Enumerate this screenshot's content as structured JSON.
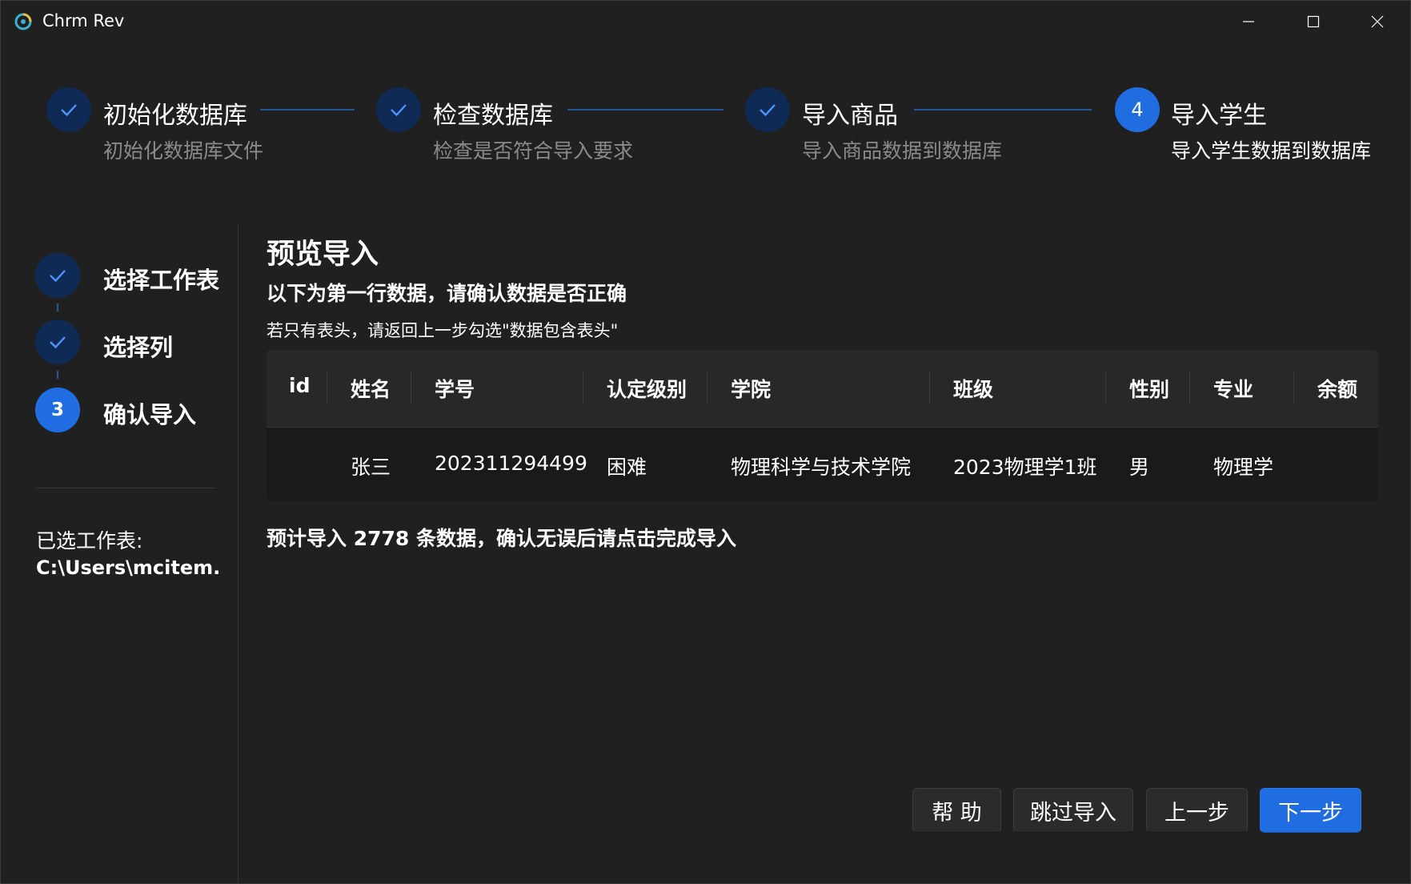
{
  "window": {
    "title": "Chrm Rev"
  },
  "stepper": [
    {
      "title": "初始化数据库",
      "desc": "初始化数据库文件",
      "state": "done"
    },
    {
      "title": "检查数据库",
      "desc": "检查是否符合导入要求",
      "state": "done"
    },
    {
      "title": "导入商品",
      "desc": "导入商品数据到数据库",
      "state": "done"
    },
    {
      "title": "导入学生",
      "desc": "导入学生数据到数据库",
      "state": "active",
      "number": "4"
    }
  ],
  "substeps": [
    {
      "label": "选择工作表",
      "state": "done"
    },
    {
      "label": "选择列",
      "state": "done"
    },
    {
      "label": "确认导入",
      "state": "active",
      "number": "3"
    }
  ],
  "sheet": {
    "label": "已选工作表:",
    "path": "C:\\Users\\mcitem..."
  },
  "main": {
    "title": "预览导入",
    "subtitle": "以下为第一行数据，请确认数据是否正确",
    "hint": "若只有表头，请返回上一步勾选\"数据包含表头\"",
    "summary": "预计导入 2778 条数据，确认无误后请点击完成导入"
  },
  "table": {
    "headers": [
      "id",
      "姓名",
      "学号",
      "认定级别",
      "学院",
      "班级",
      "性别",
      "专业",
      "余额"
    ],
    "row": [
      "",
      "张三",
      "202311294499",
      "困难",
      "物理科学与技术学院",
      "2023物理学1班",
      "男",
      "物理学",
      ""
    ]
  },
  "buttons": {
    "help": "帮 助",
    "skip": "跳过导入",
    "prev": "上一步",
    "next": "下一步"
  },
  "colors": {
    "accent": "#1f6de0",
    "done_circle": "#0f2a55",
    "background": "#202020"
  }
}
